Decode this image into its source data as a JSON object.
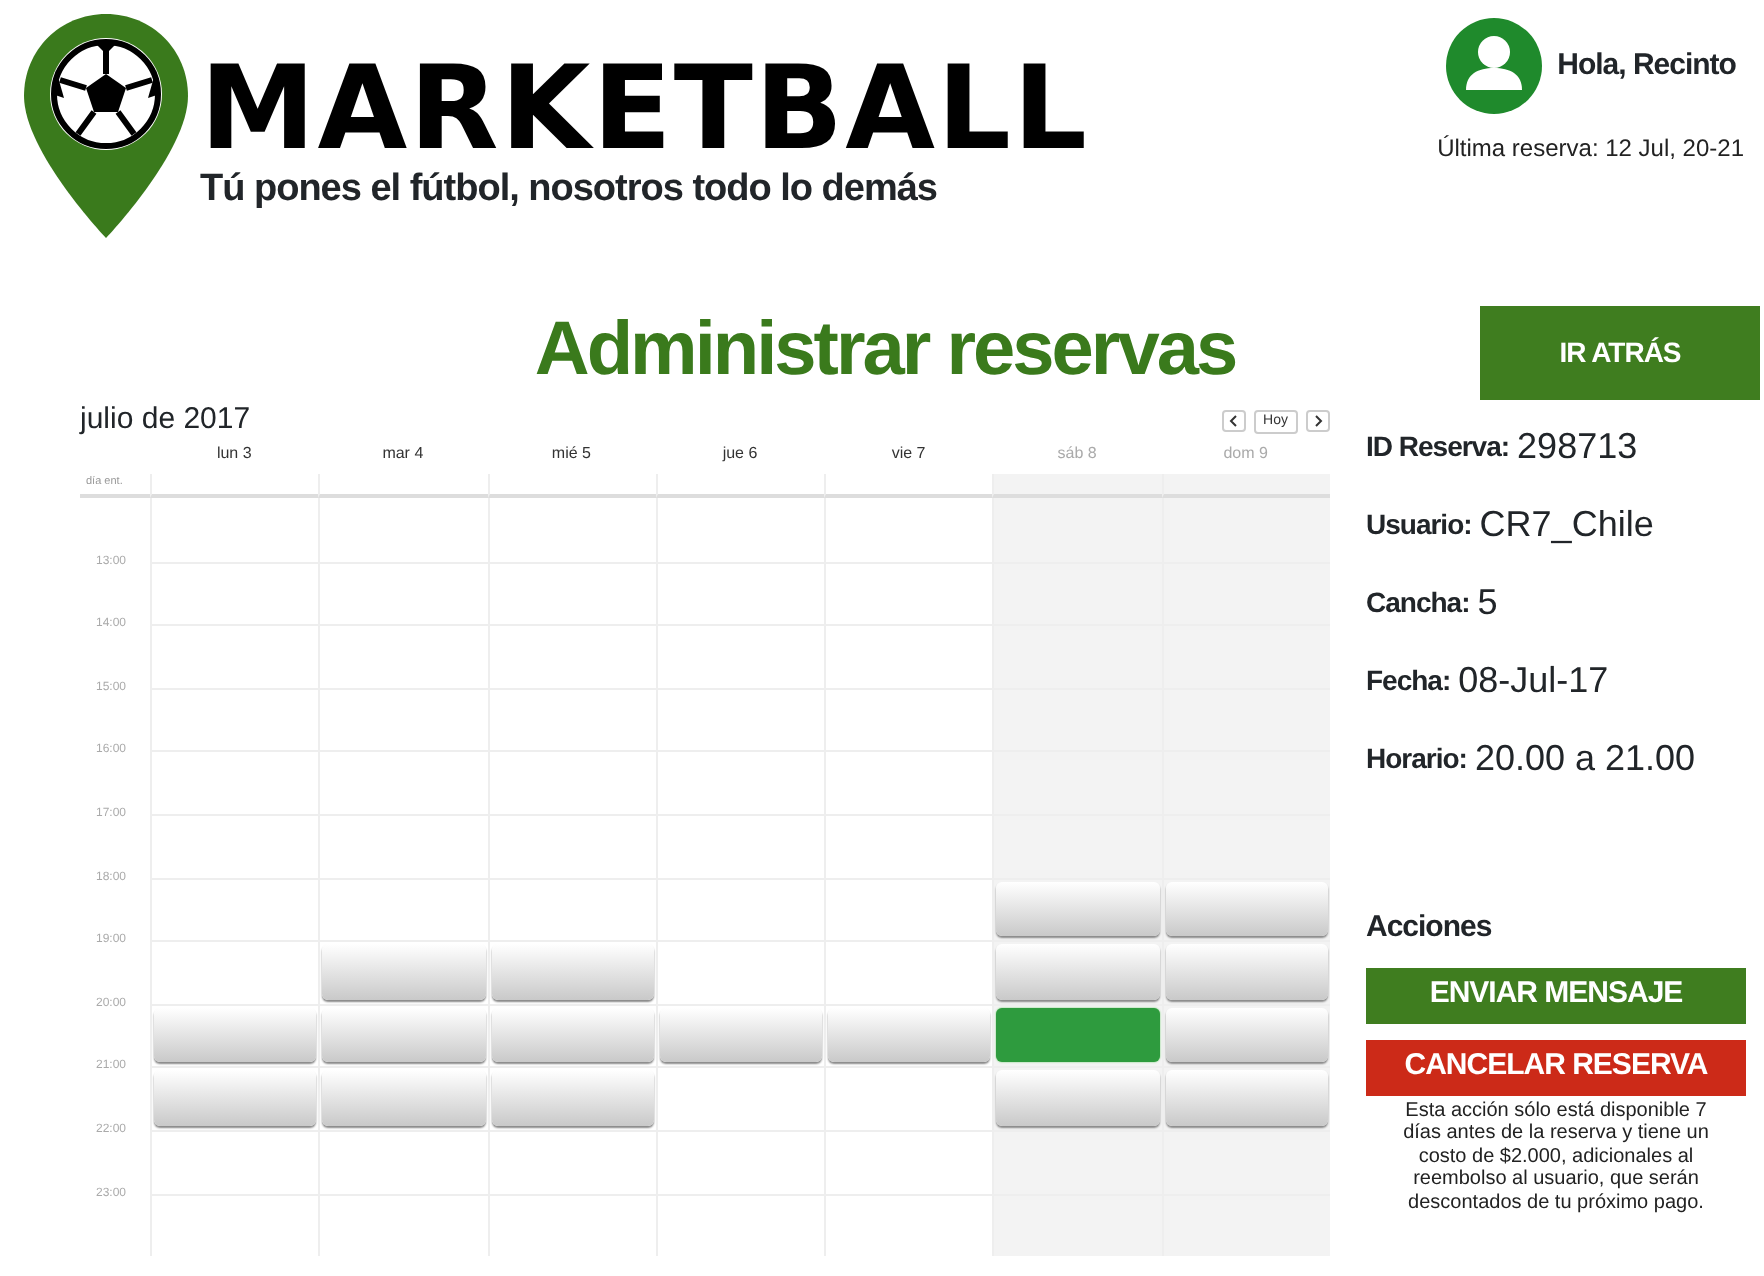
{
  "brand": {
    "name": "MARKETBALL",
    "tagline": "Tú pones el fútbol, nosotros todo lo demás"
  },
  "user": {
    "greeting": "Hola, Recinto",
    "last_booking": "Última reserva: 12 Jul, 20-21"
  },
  "page_title": "Administrar reservas",
  "back_button": "IR ATRÁS",
  "calendar": {
    "month": "julio de 2017",
    "today_button": "Hoy",
    "all_day_label": "día ent.",
    "hours": [
      "13:00",
      "14:00",
      "15:00",
      "16:00",
      "17:00",
      "18:00",
      "19:00",
      "20:00",
      "21:00",
      "22:00",
      "23:00"
    ],
    "days": [
      {
        "label": "lun 3",
        "weekend": false,
        "cells": [
          {
            "booked": false
          },
          {
            "booked": false
          },
          {
            "booked": false
          },
          {
            "booked": false
          },
          {
            "booked": false
          },
          {
            "booked": false
          },
          {
            "booked": false
          },
          {
            "booked": true,
            "selected": false
          },
          {
            "booked": true,
            "selected": false
          },
          {
            "booked": false
          },
          {
            "booked": false
          }
        ]
      },
      {
        "label": "mar 4",
        "weekend": false,
        "cells": [
          {
            "booked": false
          },
          {
            "booked": false
          },
          {
            "booked": false
          },
          {
            "booked": false
          },
          {
            "booked": false
          },
          {
            "booked": false
          },
          {
            "booked": true,
            "selected": false
          },
          {
            "booked": true,
            "selected": false
          },
          {
            "booked": true,
            "selected": false
          },
          {
            "booked": false
          },
          {
            "booked": false
          }
        ]
      },
      {
        "label": "mié 5",
        "weekend": false,
        "cells": [
          {
            "booked": false
          },
          {
            "booked": false
          },
          {
            "booked": false
          },
          {
            "booked": false
          },
          {
            "booked": false
          },
          {
            "booked": false
          },
          {
            "booked": true,
            "selected": false
          },
          {
            "booked": true,
            "selected": false
          },
          {
            "booked": true,
            "selected": false
          },
          {
            "booked": false
          },
          {
            "booked": false
          }
        ]
      },
      {
        "label": "jue 6",
        "weekend": false,
        "cells": [
          {
            "booked": false
          },
          {
            "booked": false
          },
          {
            "booked": false
          },
          {
            "booked": false
          },
          {
            "booked": false
          },
          {
            "booked": false
          },
          {
            "booked": false
          },
          {
            "booked": true,
            "selected": false
          },
          {
            "booked": false
          },
          {
            "booked": false
          },
          {
            "booked": false
          }
        ]
      },
      {
        "label": "vie 7",
        "weekend": false,
        "cells": [
          {
            "booked": false
          },
          {
            "booked": false
          },
          {
            "booked": false
          },
          {
            "booked": false
          },
          {
            "booked": false
          },
          {
            "booked": false
          },
          {
            "booked": false
          },
          {
            "booked": true,
            "selected": false
          },
          {
            "booked": false
          },
          {
            "booked": false
          },
          {
            "booked": false
          }
        ]
      },
      {
        "label": "sáb 8",
        "weekend": true,
        "cells": [
          {
            "booked": false
          },
          {
            "booked": false
          },
          {
            "booked": false
          },
          {
            "booked": false
          },
          {
            "booked": false
          },
          {
            "booked": true,
            "selected": false
          },
          {
            "booked": true,
            "selected": false
          },
          {
            "booked": true,
            "selected": true
          },
          {
            "booked": true,
            "selected": false
          },
          {
            "booked": false
          },
          {
            "booked": false
          }
        ]
      },
      {
        "label": "dom 9",
        "weekend": true,
        "cells": [
          {
            "booked": false
          },
          {
            "booked": false
          },
          {
            "booked": false
          },
          {
            "booked": false
          },
          {
            "booked": false
          },
          {
            "booked": true,
            "selected": false
          },
          {
            "booked": true,
            "selected": false
          },
          {
            "booked": true,
            "selected": false
          },
          {
            "booked": true,
            "selected": false
          },
          {
            "booked": false
          },
          {
            "booked": false
          }
        ]
      }
    ]
  },
  "details": [
    {
      "label": "ID Reserva:",
      "value": "298713"
    },
    {
      "label": "Usuario:",
      "value": "CR7_Chile"
    },
    {
      "label": "Cancha:",
      "value": "5"
    },
    {
      "label": "Fecha:",
      "value": "08-Jul-17"
    },
    {
      "label": "Horario:",
      "value": "20.00 a 21.00"
    }
  ],
  "actions_title": "Acciones",
  "actions": [
    {
      "label": "ENVIAR MENSAJE",
      "kind": "primary"
    },
    {
      "label": "CANCELAR RESERVA",
      "kind": "danger"
    }
  ],
  "note": "Esta acción sólo está disponible 7 días antes de la reserva y tiene un costo de $2.000, adicionales al reembolso al usuario, que serán descontados de tu próximo pago."
}
